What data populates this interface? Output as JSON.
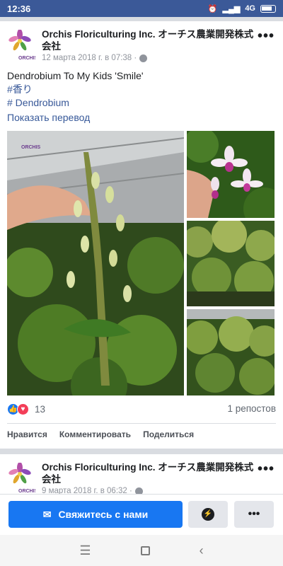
{
  "status": {
    "time": "12:36",
    "network": "4G"
  },
  "post1": {
    "page_name": "Orchis Floriculturing Inc. オーチス農業開発株式会社",
    "date": "12 марта 2018 г. в 07:38 ·",
    "title_line": "Dendrobium To My Kids 'Smile'",
    "tag1": "#香り",
    "tag2": " # Dendrobium",
    "translate": "Показать перевод",
    "reaction_count": "13",
    "shares": "1 репостов",
    "like": "Нравится",
    "comment": "Комментировать",
    "share": "Поделиться"
  },
  "post2": {
    "page_name": "Orchis Floriculturing Inc. オーチス農業開発株式会社",
    "date": "9 марта 2018 г. в 06:32 ·"
  },
  "bottom": {
    "contact_label": "Свяжитесь с нами"
  },
  "logo_text": "ORCHIS",
  "colors": {
    "brand": "#3b5998",
    "button": "#1877f2",
    "link": "#385898"
  }
}
